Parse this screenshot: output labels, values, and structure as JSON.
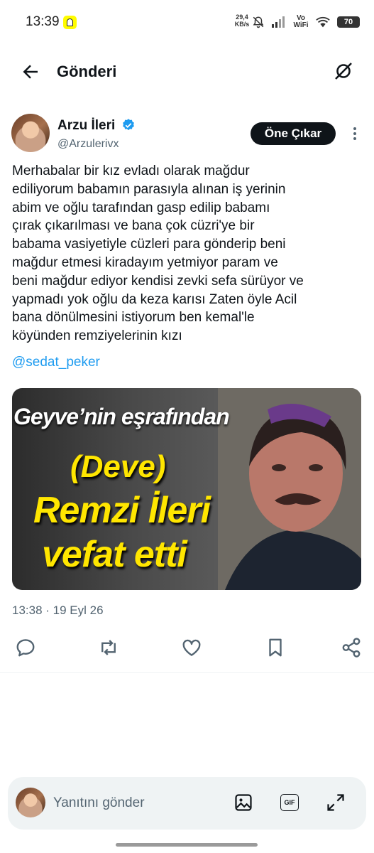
{
  "status_bar": {
    "time": "13:39",
    "net_speed": "29,4 KB/s",
    "vowifi": "Vo WiFi",
    "battery": "70",
    "icons": [
      "snapchat-icon",
      "bell-off-icon",
      "signal-icon",
      "wifi-icon",
      "battery-icon"
    ]
  },
  "header": {
    "title": "Gönderi",
    "back_icon": "arrow-left-icon",
    "grok_icon": "grok-icon"
  },
  "tweet": {
    "author_name": "Arzu İleri",
    "handle": "@Arzulerivx",
    "verified": true,
    "subscribe_label": "Öne Çıkar",
    "text": "Merhabalar bir kız evladı olarak mağdur\nediliyorum babamın parasıyla alınan iş yerinin\nabim ve oğlu tarafından gasp edilip babamı\nçırak çıkarılması ve bana çok cüzri'ye bir\nbabama vasiyetiyle cüzleri para gönderip beni\nmağdur etmesi kiradayım yetmiyor param ve\nbeni mağdur ediyor kendisi zevki sefa sürüyor ve\nyapmadı yok oğlu da keza karısı Zaten öyle Acil\nbana dönülmesini istiyorum ben kemal'le\nköyünden remziyelerinin kızı",
    "mention": "@sedat_peker",
    "media_text": {
      "line1": "Geyve’nin eşrafından",
      "line2": "(Deve)",
      "line3": "Remzi İleri",
      "line4": "vefat etti"
    },
    "timestamp": "13:38 · 19 Eyl 26"
  },
  "actions": [
    "reply-icon",
    "retweet-icon",
    "like-icon",
    "bookmark-icon",
    "share-icon"
  ],
  "reply_bar": {
    "placeholder": "Yanıtını gönder",
    "tools": [
      "image-icon",
      "gif-icon",
      "expand-icon"
    ],
    "gif_label": "GIF"
  },
  "colors": {
    "accent": "#1d9bf0",
    "text": "#0f1419",
    "secondary": "#536471",
    "media_yellow": "#ffe600"
  }
}
